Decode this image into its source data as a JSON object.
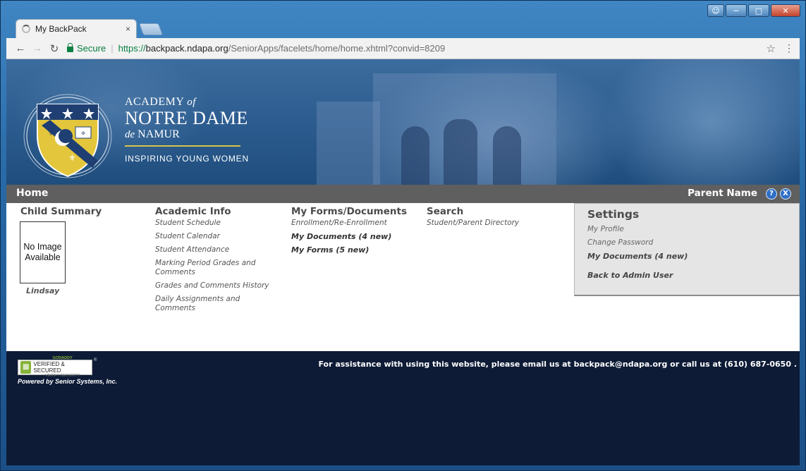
{
  "browser": {
    "tab_title": "My BackPack",
    "tab_close": "×",
    "secure_label": "Secure",
    "url_protocol": "https://",
    "url_host": "backpack.ndapa.org",
    "url_path": "/SeniorApps/facelets/home/home.xhtml?convid=8209",
    "icons": {
      "back": "arrow-left",
      "forward": "arrow-right",
      "reload": "reload",
      "bookmark": "star",
      "menu": "kebab-menu"
    }
  },
  "window_controls": [
    "person",
    "minimize",
    "maximize",
    "close"
  ],
  "banner": {
    "school_line1_a": "ACADEMY",
    "school_line1_b": "of",
    "school_line2": "NOTRE DAME",
    "school_line3_a": "de",
    "school_line3_b": "NAMUR",
    "tagline": "INSPIRING YOUNG WOMEN",
    "rule_color": "#d7c44a"
  },
  "homebar": {
    "title": "Home",
    "user": "Parent Name",
    "help_icon": "?",
    "close_icon": "X"
  },
  "child_summary": {
    "heading": "Child Summary",
    "no_image": "No Image Available",
    "child_name": "Lindsay"
  },
  "academic_info": {
    "heading": "Academic Info",
    "links": [
      "Student Schedule",
      "Student Calendar",
      "Student Attendance",
      "Marking Period Grades and Comments",
      "Grades and Comments History",
      "Daily Assignments and Comments"
    ]
  },
  "forms_documents": {
    "heading": "My Forms/Documents",
    "links": [
      {
        "label": "Enrollment/Re-Enrollment",
        "bold": false
      },
      {
        "label": "My Documents (4 new)",
        "bold": true
      },
      {
        "label": "My Forms (5 new)",
        "bold": true
      }
    ]
  },
  "search": {
    "heading": "Search",
    "links": [
      "Student/Parent Directory"
    ]
  },
  "settings": {
    "heading": "Settings",
    "links": [
      {
        "label": "My Profile",
        "bold": false
      },
      {
        "label": "Change Password",
        "bold": false
      },
      {
        "label": "My Documents (4 new)",
        "bold": true
      },
      {
        "label": "Back to Admin User",
        "bold": true
      }
    ]
  },
  "footer": {
    "badge_line1": "GODADDY",
    "badge_line2": "VERIFIED & SECURED",
    "badge_line3": "VERIFY SECURITY",
    "badge_mark": "®",
    "powered_by": "Powered by Senior Systems, Inc.",
    "assistance": "For assistance with using this website, please email us at backpack@ndapa.org or call us at (610) 687-0650 ."
  },
  "colors": {
    "homebar_bg": "#5f5f5f",
    "page_bg": "#0d1b36",
    "settings_bg": "#e5e5e5",
    "secure_green": "#0b8043"
  }
}
